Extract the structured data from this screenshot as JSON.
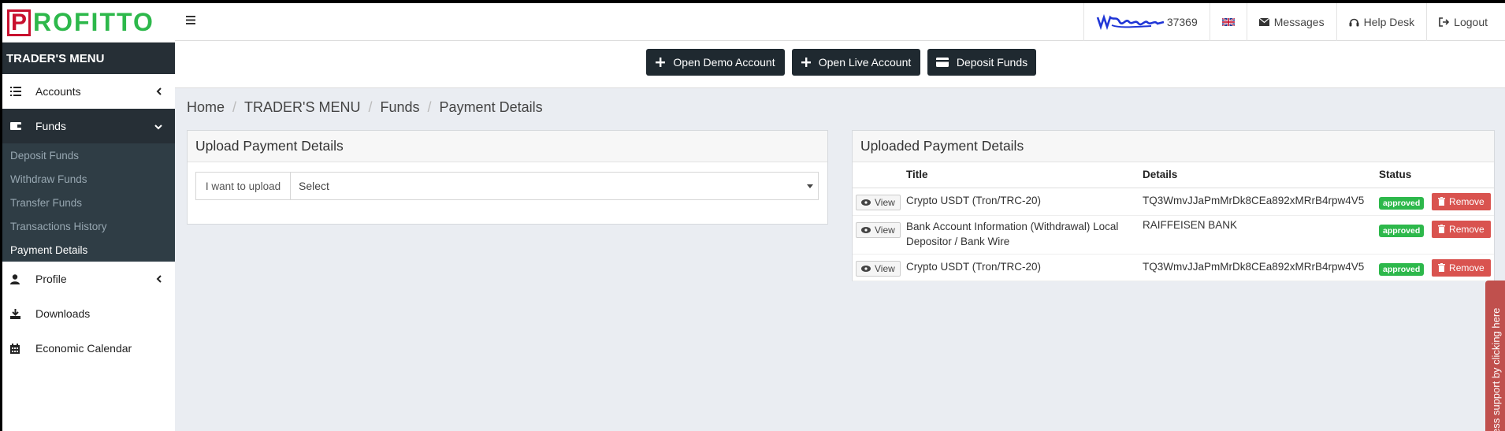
{
  "brand": {
    "logo_letter": "P",
    "logo_text": "ROFITTO"
  },
  "sidebar": {
    "header": "TRADER'S MENU",
    "items": [
      {
        "label": "Accounts"
      },
      {
        "label": "Funds"
      },
      {
        "label": "Profile"
      },
      {
        "label": "Downloads"
      },
      {
        "label": "Economic Calendar"
      }
    ],
    "funds_submenu": [
      {
        "label": "Deposit Funds"
      },
      {
        "label": "Withdraw Funds"
      },
      {
        "label": "Transfer Funds"
      },
      {
        "label": "Transactions History"
      },
      {
        "label": "Payment Details"
      }
    ]
  },
  "topbar": {
    "account_number": "37369",
    "messages": "Messages",
    "help_desk": "Help Desk",
    "logout": "Logout"
  },
  "actions": {
    "open_demo": "Open Demo Account",
    "open_live": "Open Live Account",
    "deposit": "Deposit Funds"
  },
  "breadcrumb": [
    "Home",
    "TRADER'S MENU",
    "Funds",
    "Payment Details"
  ],
  "upload_panel": {
    "title": "Upload Payment Details",
    "label": "I want to upload",
    "select_value": "Select"
  },
  "uploaded_panel": {
    "title": "Uploaded Payment Details",
    "columns": {
      "title": "Title",
      "details": "Details",
      "status": "Status"
    },
    "rows": [
      {
        "view": "View",
        "title": "Crypto USDT (Tron/TRC-20)",
        "details": "TQ3WmvJJaPmMrDk8CEa892xMRrB4rpw4V5",
        "status": "approved",
        "remove": "Remove"
      },
      {
        "view": "View",
        "title": "Bank Account Information (Withdrawal) Local Depositor / Bank Wire",
        "details": "RAIFFEISEN BANK",
        "status": "approved",
        "remove": "Remove"
      },
      {
        "view": "View",
        "title": "Crypto USDT (Tron/TRC-20)",
        "details": "TQ3WmvJJaPmMrDk8CEa892xMRrB4rpw4V5",
        "status": "approved",
        "remove": "Remove"
      }
    ]
  },
  "support_tab": "ess support by clicking here",
  "colors": {
    "dark": "#262f36",
    "brand_red": "#c8102e",
    "brand_green": "#2db84b",
    "approved": "#2db84b",
    "remove": "#d9534f"
  }
}
